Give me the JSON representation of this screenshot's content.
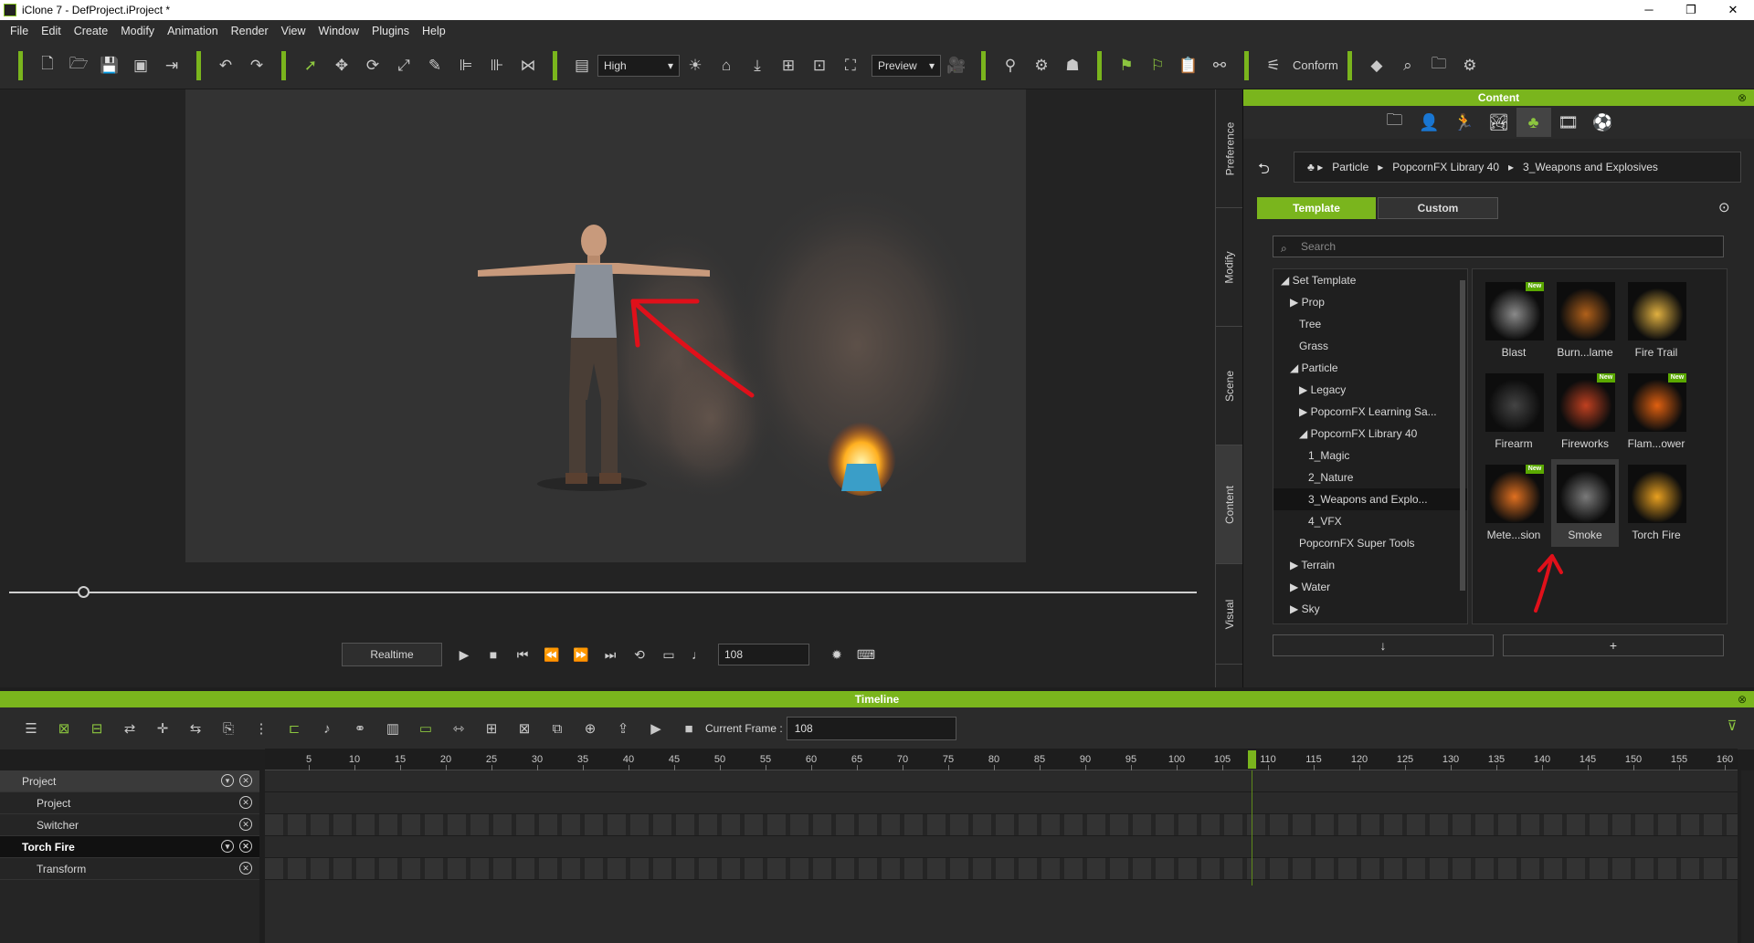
{
  "window": {
    "title": "iClone 7 - DefProject.iProject *",
    "min": "─",
    "max": "❐",
    "close": "✕"
  },
  "menu": [
    "File",
    "Edit",
    "Create",
    "Modify",
    "Animation",
    "Render",
    "View",
    "Window",
    "Plugins",
    "Help"
  ],
  "toolbar": {
    "quality": "High",
    "render_mode": "Preview",
    "conform_label": "Conform"
  },
  "playback": {
    "realtime_label": "Realtime",
    "frame": "108"
  },
  "side_tabs": [
    "Preference",
    "Modify",
    "Scene",
    "Content",
    "Visual"
  ],
  "content": {
    "header": "Content",
    "breadcrumb": [
      "Particle",
      "PopcornFX Library 40",
      "3_Weapons and Explosives"
    ],
    "template_tab": "Template",
    "custom_tab": "Custom",
    "search_placeholder": "Search",
    "tree": [
      {
        "label": "◢ Set Template",
        "indent": 0
      },
      {
        "label": "▶ Prop",
        "indent": 1
      },
      {
        "label": "Tree",
        "indent": 2
      },
      {
        "label": "Grass",
        "indent": 2
      },
      {
        "label": "◢ Particle",
        "indent": 1
      },
      {
        "label": "▶ Legacy",
        "indent": 2
      },
      {
        "label": "▶ PopcornFX Learning Sa...",
        "indent": 2
      },
      {
        "label": "◢ PopcornFX Library 40",
        "indent": 2
      },
      {
        "label": "1_Magic",
        "indent": 3
      },
      {
        "label": "2_Nature",
        "indent": 3
      },
      {
        "label": "3_Weapons and Explo...",
        "indent": 3,
        "selected": true
      },
      {
        "label": "4_VFX",
        "indent": 3
      },
      {
        "label": "PopcornFX Super Tools",
        "indent": 2
      },
      {
        "label": "▶ Terrain",
        "indent": 1
      },
      {
        "label": "▶ Water",
        "indent": 1
      },
      {
        "label": "▶ Sky",
        "indent": 1
      }
    ],
    "items": [
      {
        "label": "Blast",
        "new": true,
        "color": "#8a8a8a"
      },
      {
        "label": "Burn...lame",
        "new": false,
        "color": "#b0601a"
      },
      {
        "label": "Fire Trail",
        "new": false,
        "color": "#e0b040"
      },
      {
        "label": "Firearm",
        "new": false,
        "color": "#444444"
      },
      {
        "label": "Fireworks",
        "new": true,
        "color": "#c04020"
      },
      {
        "label": "Flam...ower",
        "new": true,
        "color": "#e06010"
      },
      {
        "label": "Mete...sion",
        "new": true,
        "color": "#e07020"
      },
      {
        "label": "Smoke",
        "new": false,
        "color": "#7a7a7a",
        "selected": true
      },
      {
        "label": "Torch Fire",
        "new": false,
        "color": "#e8a020"
      }
    ],
    "new_badge": "New",
    "down_btn": "↓",
    "add_btn": "+"
  },
  "timeline": {
    "header": "Timeline",
    "current_frame_label": "Current Frame :",
    "current_frame": "108",
    "ruler": [
      "5",
      "10",
      "15",
      "20",
      "25",
      "30",
      "35",
      "40",
      "45",
      "50",
      "55",
      "60",
      "65",
      "70",
      "75",
      "80",
      "85",
      "90",
      "95",
      "100",
      "105",
      "110",
      "115",
      "120",
      "125",
      "130",
      "135",
      "140",
      "145",
      "150",
      "155",
      "160"
    ],
    "tracks": [
      {
        "label": "Project",
        "type": "hdr"
      },
      {
        "label": "Project",
        "type": "child"
      },
      {
        "label": "Switcher",
        "type": "child"
      },
      {
        "label": "Torch Fire",
        "type": "sel"
      },
      {
        "label": "Transform",
        "type": "child"
      }
    ]
  },
  "colors": {
    "accent": "#7ab51d",
    "viewport": "#333333"
  }
}
